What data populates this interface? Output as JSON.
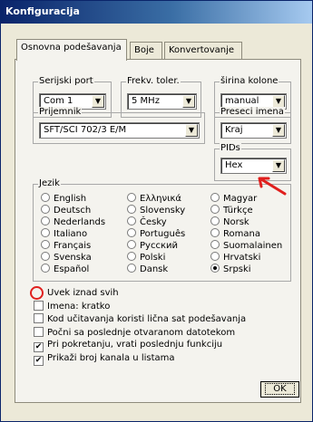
{
  "window": {
    "title": "Konfiguracija"
  },
  "tabs": [
    {
      "label": "Osnovna podešavanja"
    },
    {
      "label": "Boje"
    },
    {
      "label": "Konvertovanje"
    }
  ],
  "serial_port": {
    "legend": "Serijski port",
    "value": "Com 1"
  },
  "freq_tolerance": {
    "legend": "Frekv. toler.",
    "value": "5 MHz"
  },
  "column_width": {
    "legend": "širina kolone",
    "value": "manual"
  },
  "receiver": {
    "legend": "Prijemnik",
    "value": "SFT/SCI 702/3 E/M"
  },
  "name_cut": {
    "legend": "Preseci imena",
    "value": "Kraj"
  },
  "pids": {
    "legend": "PIDs",
    "value": "Hex"
  },
  "language": {
    "legend": "Jezik",
    "options": [
      "English",
      "Deutsch",
      "Nederlands",
      "Italiano",
      "Français",
      "Svenska",
      "Español",
      "Ελληνικά",
      "Slovensky",
      "Česky",
      "Português",
      "Русский",
      "Polski",
      "Dansk",
      "Magyar",
      "Türkçe",
      "Norsk",
      "Romana",
      "Suomalainen",
      "Hrvatski",
      "Srpski"
    ],
    "selected": "Srpski"
  },
  "checkboxes": [
    {
      "label": "Uvek iznad svih",
      "checked": false
    },
    {
      "label": "Imena: kratko",
      "checked": false
    },
    {
      "label": "Kod učitavanja koristi lična sat podešavanja",
      "checked": false
    },
    {
      "label": "Počni sa poslednje otvaranom datotekom",
      "checked": false
    },
    {
      "label": "Pri pokretanju, vrati poslednju funkciju",
      "checked": true
    },
    {
      "label": "Prikaži broj kanala u listama",
      "checked": true
    }
  ],
  "ok_label": "OK",
  "annotation_color": "#e0201e"
}
